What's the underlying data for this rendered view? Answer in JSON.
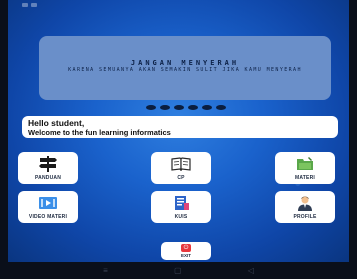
{
  "banner": {
    "title": "JANGAN MENYERAH",
    "subtitle": "KARENA SEMUANYA AKAN SEMAKIN SULIT JIKA KAMU MENYERAH"
  },
  "carousel": {
    "pages": 6,
    "active_index": 0
  },
  "greeting": {
    "line1": "Hello student,",
    "line2": "Welcome to the fun learning informatics"
  },
  "menu": [
    {
      "label": "PANDUAN",
      "icon": "signpost-icon"
    },
    {
      "label": "CP",
      "icon": "open-book-icon"
    },
    {
      "label": "MATERI",
      "icon": "folder-icon"
    },
    {
      "label": "VIDEO MATERI",
      "icon": "video-player-icon"
    },
    {
      "label": "KUIS",
      "icon": "quiz-icon"
    },
    {
      "label": "PROFILE",
      "icon": "user-profile-icon"
    }
  ],
  "exit": {
    "label": "EXIT",
    "icon": "power-icon",
    "icon_glyph": "⏻"
  },
  "navbar": {
    "menu_glyph": "≡",
    "home_glyph": "▢",
    "back_glyph": "◁"
  },
  "colors": {
    "background_blue": "#1a62cc",
    "banner_fill": "#6a8fc9",
    "exit_red": "#e8383d"
  }
}
